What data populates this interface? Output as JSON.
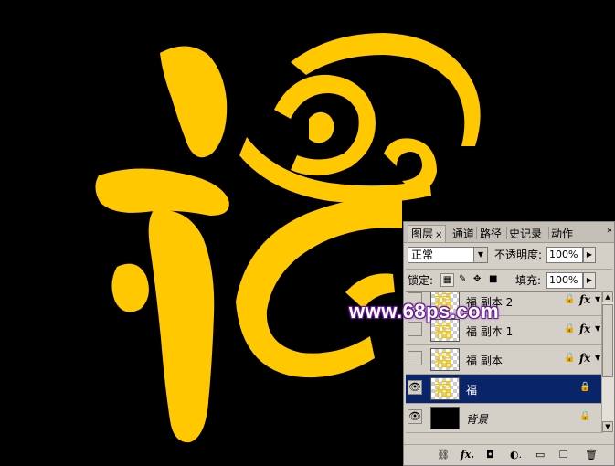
{
  "canvas": {
    "fill_color": "#ffc800",
    "background_color": "#000000",
    "watermark": "www.68ps.com"
  },
  "layers_panel": {
    "tabs": [
      {
        "label": "图层",
        "active": true,
        "close_glyph": "×"
      },
      {
        "label": "通道",
        "active": false
      },
      {
        "label": "路径",
        "active": false
      },
      {
        "label": "史记录",
        "active": false
      },
      {
        "label": "动作",
        "active": false
      }
    ],
    "menu_icon": "»",
    "blend_mode": "正常",
    "opacity_label": "不透明度:",
    "opacity_value": "100%",
    "lock_label": "锁定:",
    "fill_label": "填充:",
    "fill_value": "100%",
    "layers": [
      {
        "name": "福 副本 2",
        "visible": false,
        "selected": false,
        "locked": true,
        "fx": true,
        "thumb": "福"
      },
      {
        "name": "福 副本 1",
        "visible": false,
        "selected": false,
        "locked": true,
        "fx": true,
        "thumb": "福"
      },
      {
        "name": "福 副本",
        "visible": false,
        "selected": false,
        "locked": true,
        "fx": true,
        "thumb": "福"
      },
      {
        "name": "福",
        "visible": true,
        "selected": true,
        "locked": true,
        "fx": false,
        "thumb": "福"
      },
      {
        "name": "背景",
        "visible": true,
        "selected": false,
        "locked": true,
        "fx": false,
        "thumb": ""
      }
    ],
    "colors": {
      "panel_bg": "#d4d0c8",
      "selection": "#0a246a"
    }
  }
}
